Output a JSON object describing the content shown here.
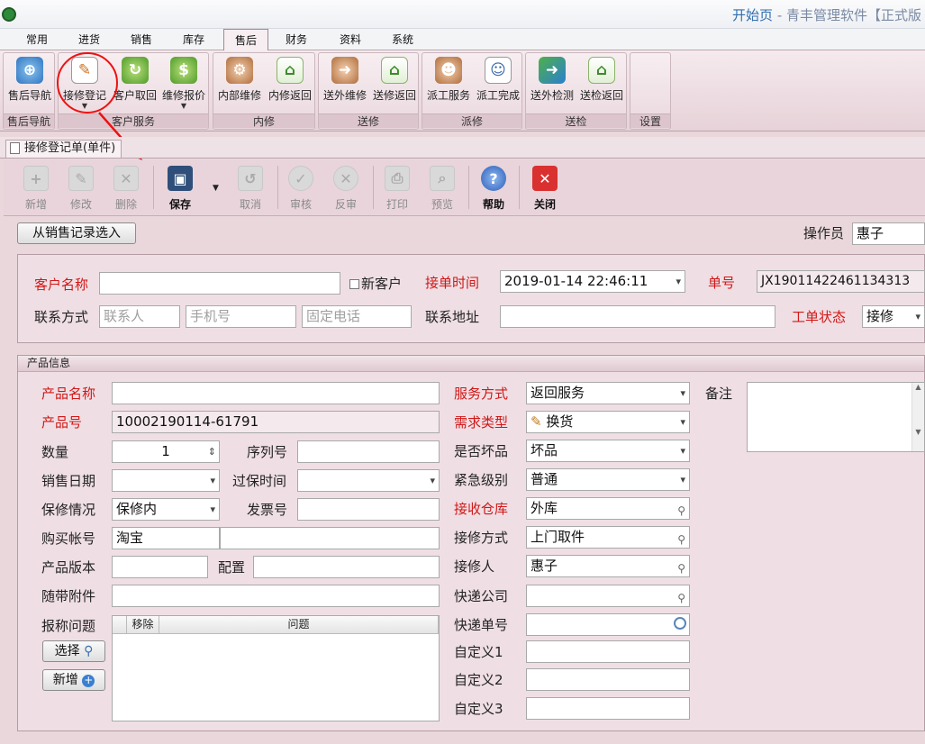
{
  "window": {
    "title_main": "开始页",
    "title_rest": " - 青丰管理软件【正式版"
  },
  "menu_tabs": [
    "常用",
    "进货",
    "销售",
    "库存",
    "售后",
    "财务",
    "资料",
    "系统"
  ],
  "ribbon": {
    "groups": [
      "售后导航",
      "客户服务",
      "内修",
      "送修",
      "派修",
      "送检",
      "设置"
    ],
    "buttons": [
      "售后导航",
      "接修登记",
      "客户取回",
      "维修报价",
      "内部维修",
      "内修返回",
      "送外维修",
      "送修返回",
      "派工服务",
      "派工完成",
      "送外检测",
      "送检返回"
    ]
  },
  "document_tab": "接修登记单(单件)",
  "toolbar": [
    "新增",
    "修改",
    "删除",
    "保存",
    "取消",
    "审核",
    "反审",
    "打印",
    "预览",
    "帮助",
    "关闭"
  ],
  "header": {
    "select_from_sales": "从销售记录选入",
    "operator_label": "操作员",
    "operator": "惠子"
  },
  "customer": {
    "name_label": "客户名称",
    "name": "",
    "new_customer": "新客户",
    "receive_time_label": "接单时间",
    "receive_time": "2019-01-14 22:46:11",
    "order_no_label": "单号",
    "order_no": "JX19011422461134313",
    "contact_label": "联系方式",
    "contact_ph": "联系人",
    "mobile_ph": "手机号",
    "phone_ph": "固定电话",
    "address_label": "联系地址",
    "address": "",
    "status_label": "工单状态",
    "status": "接修"
  },
  "product": {
    "panel_title": "产品信息",
    "name_label": "产品名称",
    "name": "",
    "no_label": "产品号",
    "no": "10002190114-61791",
    "qty_label": "数量",
    "qty": "1",
    "serial_label": "序列号",
    "sale_date_label": "销售日期",
    "warranty_time_label": "过保时间",
    "warranty_label": "保修情况",
    "warranty": "保修内",
    "invoice_label": "发票号",
    "account_label": "购买帐号",
    "account": "淘宝",
    "version_label": "产品版本",
    "config_label": "配置",
    "accessory_label": "随带附件",
    "issue_label": "报称问题",
    "grid_remove": "移除",
    "grid_issue": "问题",
    "select_btn": "选择",
    "add_btn": "新增",
    "service_label": "服务方式",
    "service": "返回服务",
    "demand_label": "需求类型",
    "demand": "换货",
    "broken_label": "是否坏品",
    "broken": "坏品",
    "urgency_label": "紧急级别",
    "urgency": "普通",
    "warehouse_label": "接收仓库",
    "warehouse": "外库",
    "repair_mode_label": "接修方式",
    "repair_mode": "上门取件",
    "receiver_label": "接修人",
    "receiver": "惠子",
    "courier_label": "快递公司",
    "courier_no_label": "快递单号",
    "custom1_label": "自定义1",
    "custom2_label": "自定义2",
    "custom3_label": "自定义3",
    "remark_label": "备注"
  }
}
